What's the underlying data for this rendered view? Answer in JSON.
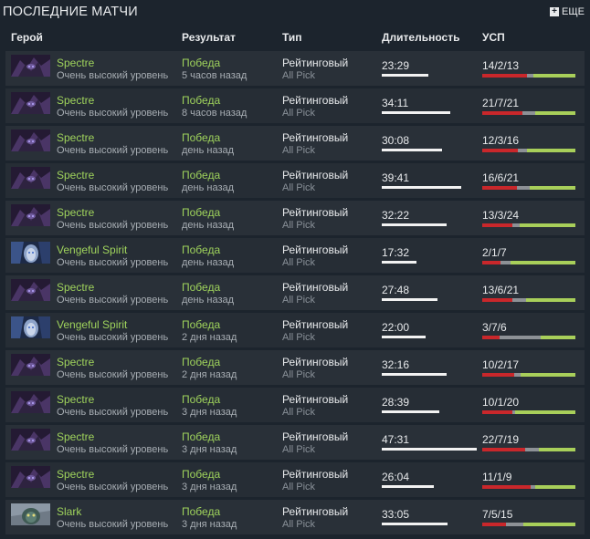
{
  "header": {
    "title": "ПОСЛЕДНИЕ МАТЧИ",
    "more_label": "ЕЩЕ",
    "plus_glyph": "+"
  },
  "columns": {
    "hero": "Герой",
    "result": "Результат",
    "type": "Тип",
    "duration": "Длительность",
    "kda": "УСП"
  },
  "max_duration_minutes": 47.5,
  "matches": [
    {
      "hero": "Spectre",
      "hero_icon": "spectre-portrait",
      "skill": "Очень высокий уровень",
      "result": "Победа",
      "when": "5 часов назад",
      "type": "Рейтинговый",
      "mode": "All Pick",
      "duration": "23:29",
      "minutes": 23.48,
      "kda": "14/2/13",
      "k": 14,
      "d": 2,
      "a": 13
    },
    {
      "hero": "Spectre",
      "hero_icon": "spectre-portrait",
      "skill": "Очень высокий уровень",
      "result": "Победа",
      "when": "8 часов назад",
      "type": "Рейтинговый",
      "mode": "All Pick",
      "duration": "34:11",
      "minutes": 34.18,
      "kda": "21/7/21",
      "k": 21,
      "d": 7,
      "a": 21
    },
    {
      "hero": "Spectre",
      "hero_icon": "spectre-portrait",
      "skill": "Очень высокий уровень",
      "result": "Победа",
      "when": "день назад",
      "type": "Рейтинговый",
      "mode": "All Pick",
      "duration": "30:08",
      "minutes": 30.13,
      "kda": "12/3/16",
      "k": 12,
      "d": 3,
      "a": 16
    },
    {
      "hero": "Spectre",
      "hero_icon": "spectre-portrait",
      "skill": "Очень высокий уровень",
      "result": "Победа",
      "when": "день назад",
      "type": "Рейтинговый",
      "mode": "All Pick",
      "duration": "39:41",
      "minutes": 39.68,
      "kda": "16/6/21",
      "k": 16,
      "d": 6,
      "a": 21
    },
    {
      "hero": "Spectre",
      "hero_icon": "spectre-portrait",
      "skill": "Очень высокий уровень",
      "result": "Победа",
      "when": "день назад",
      "type": "Рейтинговый",
      "mode": "All Pick",
      "duration": "32:22",
      "minutes": 32.37,
      "kda": "13/3/24",
      "k": 13,
      "d": 3,
      "a": 24
    },
    {
      "hero": "Vengeful Spirit",
      "hero_icon": "vengeful-spirit-portrait",
      "skill": "Очень высокий уровень",
      "result": "Победа",
      "when": "день назад",
      "type": "Рейтинговый",
      "mode": "All Pick",
      "duration": "17:32",
      "minutes": 17.53,
      "kda": "2/1/7",
      "k": 2,
      "d": 1,
      "a": 7
    },
    {
      "hero": "Spectre",
      "hero_icon": "spectre-portrait",
      "skill": "Очень высокий уровень",
      "result": "Победа",
      "when": "день назад",
      "type": "Рейтинговый",
      "mode": "All Pick",
      "duration": "27:48",
      "minutes": 27.8,
      "kda": "13/6/21",
      "k": 13,
      "d": 6,
      "a": 21
    },
    {
      "hero": "Vengeful Spirit",
      "hero_icon": "vengeful-spirit-portrait",
      "skill": "Очень высокий уровень",
      "result": "Победа",
      "when": "2 дня назад",
      "type": "Рейтинговый",
      "mode": "All Pick",
      "duration": "22:00",
      "minutes": 22.0,
      "kda": "3/7/6",
      "k": 3,
      "d": 7,
      "a": 6
    },
    {
      "hero": "Spectre",
      "hero_icon": "spectre-portrait",
      "skill": "Очень высокий уровень",
      "result": "Победа",
      "when": "2 дня назад",
      "type": "Рейтинговый",
      "mode": "All Pick",
      "duration": "32:16",
      "minutes": 32.27,
      "kda": "10/2/17",
      "k": 10,
      "d": 2,
      "a": 17
    },
    {
      "hero": "Spectre",
      "hero_icon": "spectre-portrait",
      "skill": "Очень высокий уровень",
      "result": "Победа",
      "when": "3 дня назад",
      "type": "Рейтинговый",
      "mode": "All Pick",
      "duration": "28:39",
      "minutes": 28.65,
      "kda": "10/1/20",
      "k": 10,
      "d": 1,
      "a": 20
    },
    {
      "hero": "Spectre",
      "hero_icon": "spectre-portrait",
      "skill": "Очень высокий уровень",
      "result": "Победа",
      "when": "3 дня назад",
      "type": "Рейтинговый",
      "mode": "All Pick",
      "duration": "47:31",
      "minutes": 47.52,
      "kda": "22/7/19",
      "k": 22,
      "d": 7,
      "a": 19
    },
    {
      "hero": "Spectre",
      "hero_icon": "spectre-portrait",
      "skill": "Очень высокий уровень",
      "result": "Победа",
      "when": "3 дня назад",
      "type": "Рейтинговый",
      "mode": "All Pick",
      "duration": "26:04",
      "minutes": 26.07,
      "kda": "11/1/9",
      "k": 11,
      "d": 1,
      "a": 9
    },
    {
      "hero": "Slark",
      "hero_icon": "slark-portrait",
      "skill": "Очень высокий уровень",
      "result": "Победа",
      "when": "3 дня назад",
      "type": "Рейтинговый",
      "mode": "All Pick",
      "duration": "33:05",
      "minutes": 33.08,
      "kda": "7/5/15",
      "k": 7,
      "d": 5,
      "a": 15
    }
  ],
  "colors": {
    "win": "#9fd35c",
    "kills": "#c9272b",
    "deaths": "#8d9196",
    "assists": "#a8cf5a"
  }
}
